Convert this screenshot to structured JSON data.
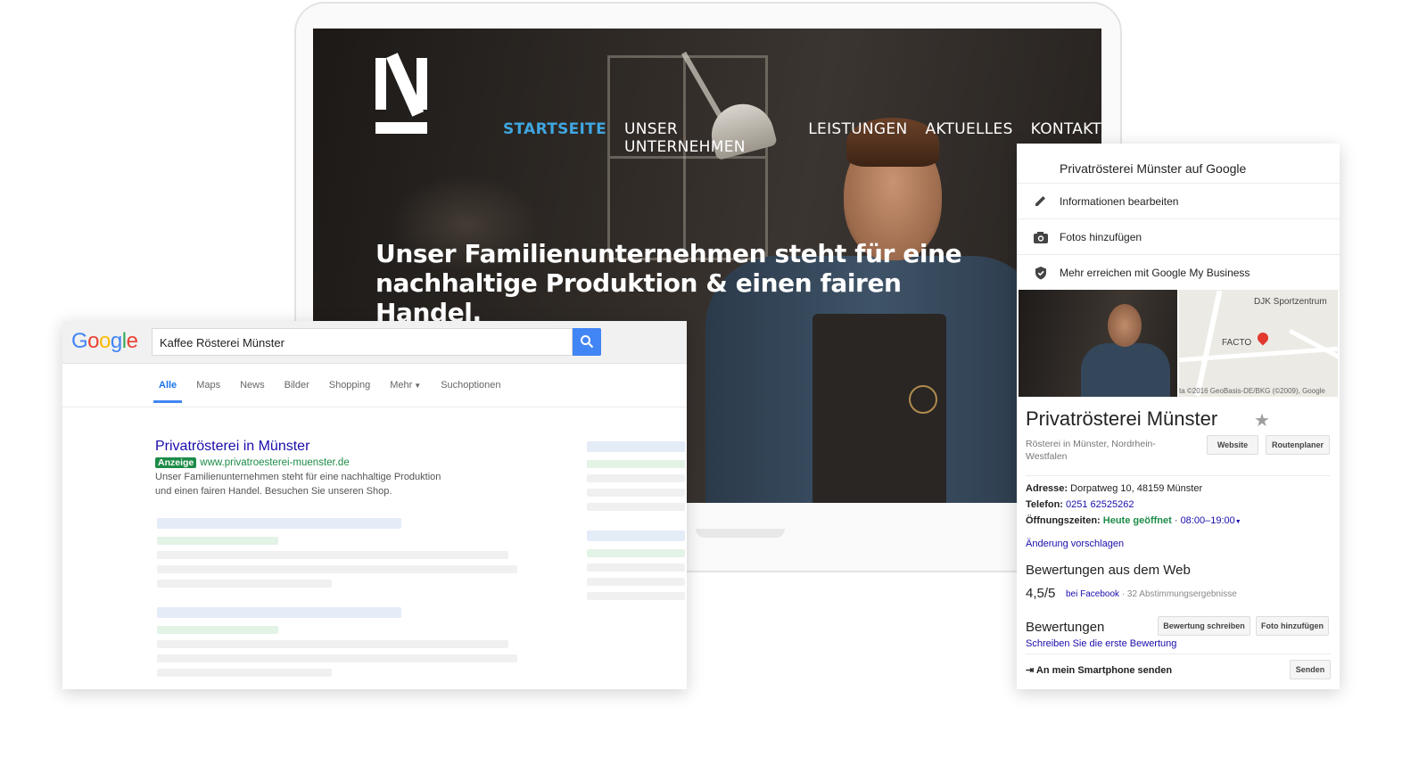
{
  "website": {
    "nav": [
      {
        "label": "STARTSEITE",
        "active": true
      },
      {
        "label": "UNSER UNTERNEHMEN",
        "active": false
      },
      {
        "label": "LEISTUNGEN",
        "active": false
      },
      {
        "label": "AKTUELLES",
        "active": false
      },
      {
        "label": "KONTAKT",
        "active": false
      }
    ],
    "hero_line1": "Unser Familienunternehmen steht für eine",
    "hero_line2": "nachhaltige Produktion & einen fairen Handel.",
    "accent_color": "#3fa6e0"
  },
  "google_search": {
    "logo": "Google",
    "query": "Kaffee Rösterei Münster",
    "tabs": [
      "Alle",
      "Maps",
      "News",
      "Bilder",
      "Shopping",
      "Mehr",
      "Suchoptionen"
    ],
    "active_tab": "Alle",
    "ad": {
      "title": "Privatrösterei in Münster",
      "badge": "Anzeige",
      "url": "www.privatroesterei-muenster.de",
      "description_line1": "Unser Familienunternehmen steht für eine nachhaltige Produktion",
      "description_line2": "und einen fairen Handel. Besuchen Sie unseren Shop."
    }
  },
  "knowledge_panel": {
    "header": "Privatrösterei Münster auf Google",
    "actions": [
      {
        "label": "Informationen bearbeiten",
        "icon": "pencil-icon"
      },
      {
        "label": "Fotos hinzufügen",
        "icon": "camera-icon"
      },
      {
        "label": "Mehr erreichen mit Google My Business",
        "icon": "shield-icon"
      }
    ],
    "map_labels": {
      "poi": "DJK Sportzentrum",
      "place": "FACTO",
      "copyright": "ta ©2016 GeoBasis-DE/BKG (©2009), Google"
    },
    "name": "Privatrösterei Münster",
    "category": "Rösterei in Münster, Nordrhein-Westfalen",
    "website_button": "Website",
    "route_button": "Routenplaner",
    "address_label": "Adresse:",
    "address": "Dorpatweg 10, 48159 Münster",
    "phone_label": "Telefon:",
    "phone": "0251 62525262",
    "hours_label": "Öffnungszeiten:",
    "hours_status": "Heute geöffnet",
    "hours": "08:00–19:00",
    "suggest_edit": "Änderung vorschlagen",
    "web_reviews_title": "Bewertungen aus dem Web",
    "rating": "4,5/5",
    "rating_source": "bei Facebook",
    "rating_count": " · 32 Abstimmungsergebnisse",
    "reviews_title": "Bewertungen",
    "write_review_button": "Bewertung schreiben",
    "add_photo_button": "Foto hinzufügen",
    "first_review_link": "Schreiben Sie die erste Bewertung",
    "send_to_phone": "An mein Smartphone senden",
    "send_button": "Senden"
  }
}
